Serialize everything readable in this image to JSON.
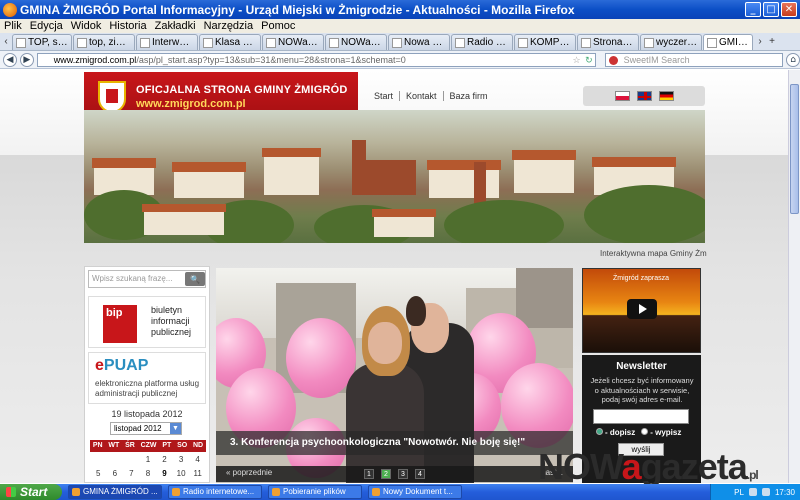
{
  "window": {
    "title": "GMINA ŻMIGRÓD Portal Informacyjny - Urząd Miejski w Żmigrodzie - Aktualności - Mozilla Firefox"
  },
  "menubar": {
    "items": [
      "Plik",
      "Edycja",
      "Widok",
      "Historia",
      "Zakładki",
      "Narzędzia",
      "Pomoc"
    ]
  },
  "tabs": [
    {
      "label": "TOP, szary..."
    },
    {
      "label": "top, zielon..."
    },
    {
      "label": "Interwencj..."
    },
    {
      "label": "Klasa okrę..."
    },
    {
      "label": "NOWa – G..."
    },
    {
      "label": "NOWa – G..."
    },
    {
      "label": "Nowa Gaz..."
    },
    {
      "label": "Radio ZET ..."
    },
    {
      "label": "KOMPLET ..."
    },
    {
      "label": "Strona Int..."
    },
    {
      "label": "wyczerpuj..."
    },
    {
      "label": "GMINA ..."
    }
  ],
  "navbar": {
    "url_domain": "www.zmigrod.com.pl",
    "url_path": "/asp/pl_start.asp?typ=13&sub=31&menu=28&strona=1&schemat=0",
    "search_placeholder": "SweetIM Search"
  },
  "site": {
    "logo_line1": "OFICJALNA STRONA GMINY ŻMIGRÓD",
    "logo_line2": "www.zmigrod.com.pl",
    "nav": [
      "Start",
      "Kontakt",
      "Baza firm"
    ],
    "map_link": "Interaktywna mapa Gminy Żm",
    "search_placeholder": "Wpisz szukaną frazę...",
    "bip_logo": "bip",
    "bip_text": "biuletyn informacji publicznej",
    "epuap_logo_e": "e",
    "epuap_logo_rest": "PUAP",
    "epuap_text": "elektroniczna platforma usług administracji publicznej",
    "calendar_date": "19 listopada 2012",
    "calendar_month": "listopad 2012",
    "calendar_days": [
      "PN",
      "WT",
      "ŚR",
      "CZW",
      "PT",
      "SO",
      "ND"
    ],
    "calendar_week1": [
      "",
      "",
      "",
      "1",
      "2",
      "3",
      "4"
    ],
    "calendar_week2": [
      "5",
      "6",
      "7",
      "8",
      "9",
      "10",
      "11"
    ],
    "slider_caption": "3. Konferencja psychoonkologiczna \"Nowotwór. Nie boję się!\"",
    "slider_prev": "« poprzednie",
    "slider_next": "nast...",
    "slider_pages": [
      "1",
      "2",
      "3",
      "4"
    ],
    "video_text": "Żmigród zaprasza",
    "newsletter_title": "Newsletter",
    "newsletter_desc": "Jeżeli chcesz być informowany o aktualnościach w serwisie, podaj swój adres e-mail.",
    "newsletter_add": "- dopisz",
    "newsletter_remove": "- wypisz",
    "newsletter_submit": "wyślij"
  },
  "watermark": {
    "main": "NOW",
    "a": "a",
    "rest": "gazeta",
    "pl": ".pl"
  },
  "taskbar": {
    "start": "Start",
    "items": [
      "GMINA ŻMIGRÓD ...",
      "Radio internetowe...",
      "Pobieranie plików",
      "Nowy Dokument t..."
    ],
    "lang": "PL",
    "clock": "17:30"
  }
}
